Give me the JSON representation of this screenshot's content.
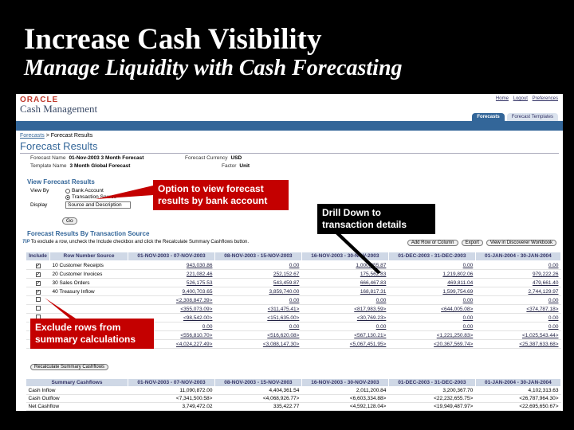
{
  "slide": {
    "title": "Increase Cash Visibility",
    "subtitle": "Manage Liquidity with Cash Forecasting"
  },
  "app": {
    "vendor": "ORACLE",
    "name": "Cash Management",
    "global_links": [
      "Home",
      "Logout",
      "Preferences"
    ],
    "tabs": [
      {
        "label": "Forecasts",
        "active": true
      },
      {
        "label": "Forecast Templates",
        "active": false
      }
    ],
    "colors": {
      "accent": "#336699",
      "callout": "#c40000"
    }
  },
  "breadcrumb": {
    "parent": "Forecasts",
    "separator": ">",
    "current": "Forecast Results"
  },
  "page_title": "Forecast Results",
  "header_info": {
    "forecast_name_label": "Forecast Name",
    "forecast_name": "01-Nov-2003 3 Month Forecast",
    "template_name_label": "Template Name",
    "template_name": "3 Month Global Forecast",
    "currency_label": "Forecast Currency",
    "currency": "USD",
    "factor_label": "Factor",
    "factor": "Unit"
  },
  "view_panel": {
    "title": "View Forecast Results",
    "view_by_label": "View By",
    "options": [
      "Bank Account",
      "Transaction Source"
    ],
    "selected_option": "Transaction Source",
    "display_label": "Display",
    "display_value": "Source and Description",
    "go_label": "Go"
  },
  "results": {
    "title": "Forecast Results By Transaction Source",
    "tip_prefix": "TIP",
    "tip_text": "To exclude a row, uncheck the Include checkbox and click the Recalculate Summary Cashflows button.",
    "buttons": [
      "Add Row or Column",
      "Export",
      "View in Discoverer Workbook"
    ],
    "headers": [
      "Include",
      "Row Number Source",
      "01-NOV-2003 - 07-NOV-2003",
      "08-NOV-2003 - 15-NOV-2003",
      "16-NOV-2003 - 30-NOV-2003",
      "01-DEC-2003 - 31-DEC-2003",
      "01-JAN-2004 - 30-JAN-2004"
    ],
    "rows": [
      {
        "include": true,
        "num": "10",
        "source": "Customer Receipts",
        "values": [
          "943,030.86",
          "0.00",
          "1,000,355.87",
          "0.00",
          "0.00"
        ]
      },
      {
        "include": true,
        "num": "20",
        "source": "Customer Invoices",
        "values": [
          "221,082.46",
          "252,152.67",
          "175,562.83",
          "1,219,802.06",
          "979,222.26"
        ]
      },
      {
        "include": true,
        "num": "30",
        "source": "Sales Orders",
        "values": [
          "526,175.53",
          "543,459.87",
          "666,467.83",
          "469,811.04",
          "479,661.40"
        ]
      },
      {
        "include": true,
        "num": "40",
        "source": "Treasury Inflow",
        "values": [
          "9,400,703.65",
          "3,859,740.00",
          "168,817.31",
          "1,599,754.69",
          "2,744,129.97"
        ]
      },
      {
        "include": false,
        "num": "",
        "source": "",
        "values": [
          "<2,308,847.39>",
          "0.00",
          "0.00",
          "0.00",
          "0.00"
        ]
      },
      {
        "include": false,
        "num": "",
        "source": "",
        "values": [
          "<355,073.09>",
          "<311,475.41>",
          "<817,983.59>",
          "<644,005.08>",
          "<374,787.18>"
        ]
      },
      {
        "include": false,
        "num": "",
        "source": "",
        "values": [
          "<98,542.00>",
          "<151,635.00>",
          "<30,769.23>",
          "0.00",
          "0.00"
        ]
      },
      {
        "include": false,
        "num": "",
        "source": "",
        "values": [
          "0.00",
          "0.00",
          "0.00",
          "0.00",
          "0.00"
        ]
      },
      {
        "include": false,
        "num": "",
        "source": "",
        "values": [
          "<556,810.70>",
          "<516,620.08>",
          "<567,130.21>",
          "<1,221,250.83>",
          "<1,025,543.44>"
        ]
      },
      {
        "include": true,
        "num": "100",
        "source": "Treasury Outflow",
        "values": [
          "<4,024,227.49>",
          "<3,088,147.30>",
          "<5,067,451.95>",
          "<20,367,569.74>",
          "<25,387,633.68>"
        ]
      }
    ],
    "recalc_label": "Recalculate Summary Cashflows"
  },
  "summary": {
    "headers": [
      "Summary Cashflows",
      "01-NOV-2003 - 07-NOV-2003",
      "08-NOV-2003 - 15-NOV-2003",
      "16-NOV-2003 - 30-NOV-2003",
      "01-DEC-2003 - 31-DEC-2003",
      "01-JAN-2004 - 30-JAN-2004"
    ],
    "rows": [
      {
        "label": "Cash Inflow",
        "values": [
          "11,090,872.00",
          "4,404,361.54",
          "2,011,200.84",
          "3,200,367.70",
          "4,102,313.63"
        ]
      },
      {
        "label": "Cash Outflow",
        "values": [
          "<7,341,500.58>",
          "<4,068,926.77>",
          "<6,603,334.88>",
          "<22,232,655.75>",
          "<26,787,964.30>"
        ]
      },
      {
        "label": "Net Cashflow",
        "values": [
          "3,749,472.02",
          "335,422.77",
          "<4,592,128.04>",
          "<19,949,487.97>",
          "<22,695,650.67>"
        ]
      }
    ]
  },
  "callouts": {
    "view_option": "Option to view forecast results by bank account",
    "drill_down": "Drill Down to transaction details",
    "exclude_rows": "Exclude rows from summary calculations"
  }
}
